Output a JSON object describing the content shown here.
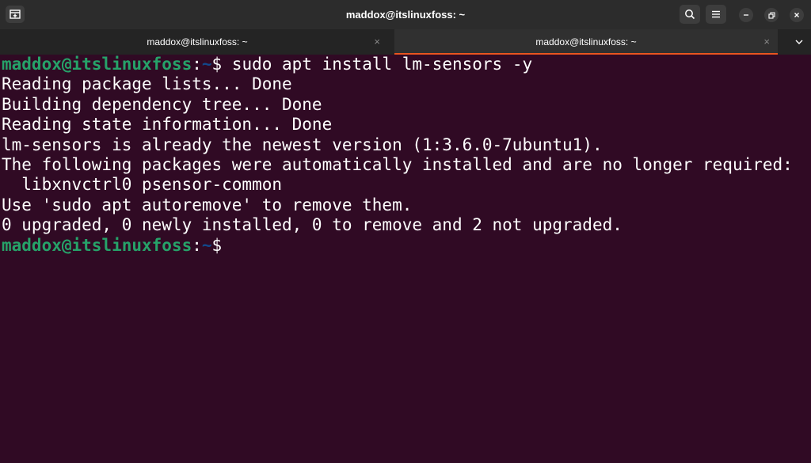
{
  "window": {
    "title": "maddox@itslinuxfoss: ~"
  },
  "tabs": [
    {
      "label": "maddox@itslinuxfoss: ~",
      "active": false
    },
    {
      "label": "maddox@itslinuxfoss: ~",
      "active": true
    }
  ],
  "tab_close_glyph": "×",
  "icons": {
    "new_tab": "new-tab-icon",
    "search": "search-icon",
    "menu": "hamburger-menu-icon",
    "minimize": "minimize-icon",
    "restore": "restore-icon",
    "close": "close-icon",
    "tabs_dropdown": "chevron-down-icon"
  },
  "colors": {
    "terminal_background": "#300a24",
    "prompt_user": "#26a269",
    "prompt_path": "#12488b",
    "active_tab_accent": "#e95420"
  },
  "prompt": {
    "user_host": "maddox@itslinuxfoss",
    "colon": ":",
    "path": "~",
    "symbol": "$ "
  },
  "terminal": {
    "command": "sudo apt install lm-sensors -y",
    "output": [
      "Reading package lists... Done",
      "Building dependency tree... Done",
      "Reading state information... Done",
      "lm-sensors is already the newest version (1:3.6.0-7ubuntu1).",
      "The following packages were automatically installed and are no longer required:",
      "  libxnvctrl0 psensor-common",
      "Use 'sudo apt autoremove' to remove them.",
      "0 upgraded, 0 newly installed, 0 to remove and 2 not upgraded."
    ]
  }
}
